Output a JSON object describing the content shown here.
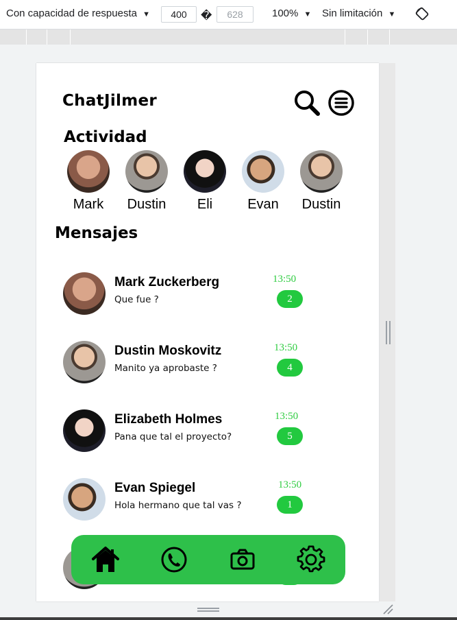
{
  "devtools": {
    "device_mode": "Con capacidad de respuesta",
    "width": "400",
    "dims_separator": "�",
    "height": "628",
    "zoom": "100%",
    "throttle": "Sin limitación",
    "rotate_icon": "rotate-icon"
  },
  "app": {
    "title": "ChatJilmer",
    "search_icon": "search-icon",
    "menu_icon": "menu-icon"
  },
  "activity": {
    "title": "Actividad",
    "stories": [
      {
        "name": "Mark",
        "avatar_color": "#8a5a48"
      },
      {
        "name": "Dustin",
        "avatar_color": "#6e6a66"
      },
      {
        "name": "Eli",
        "avatar_color": "#1e1e2a"
      },
      {
        "name": "Evan",
        "avatar_color": "#5b4a3c"
      },
      {
        "name": "Dustin",
        "avatar_color": "#6e6a66"
      }
    ]
  },
  "messages": {
    "title": "Mensajes",
    "items": [
      {
        "name": "Mark Zuckerberg",
        "text": "Que fue ?",
        "time": "13:50",
        "unread": "2",
        "avatar_color": "#8a5a48"
      },
      {
        "name": "Dustin Moskovitz",
        "text": "Manito ya aprobaste ?",
        "time": "13:50",
        "unread": "4",
        "avatar_color": "#6e6a66"
      },
      {
        "name": "Elizabeth Holmes",
        "text": "Pana que tal el proyecto?",
        "time": "13:50",
        "unread": "5",
        "avatar_color": "#1e1e2a"
      },
      {
        "name": "Evan Spiegel",
        "text": "Hola hermano que tal vas ?",
        "time": "13:50",
        "unread": "1",
        "avatar_color": "#5b4a3c"
      }
    ]
  },
  "bottom_nav": {
    "background": "#2ec04a",
    "items": [
      "home-icon",
      "phone-icon",
      "camera-icon",
      "settings-icon"
    ]
  },
  "colors": {
    "accent": "#2ec04a",
    "time": "#2ecc40",
    "badge": "#22c93f"
  }
}
